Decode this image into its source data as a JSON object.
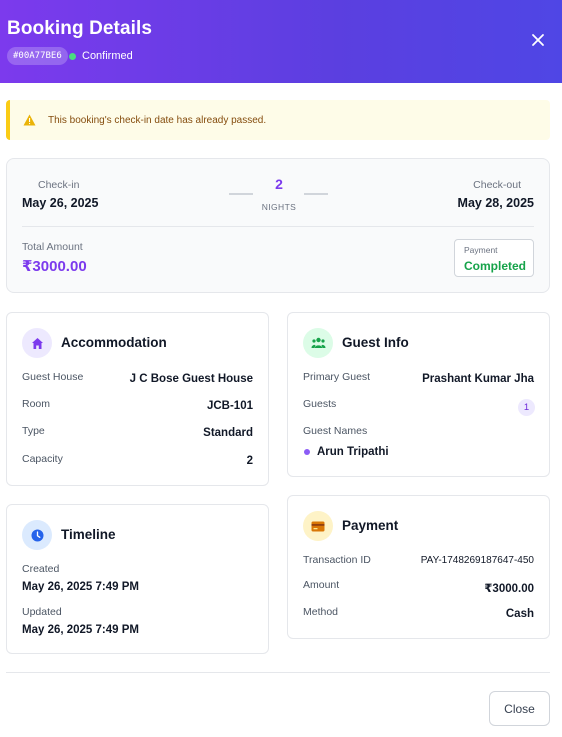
{
  "header": {
    "title": "Booking Details",
    "booking_id": "#00A77BE6",
    "status": "Confirmed",
    "close_icon": "close-icon"
  },
  "alert": {
    "icon": "warning-icon",
    "text": "This booking's check-in date has already passed."
  },
  "summary": {
    "checkin_label": "Check-in",
    "checkin_date": "May 26, 2025",
    "nights_value": "2",
    "nights_label": "NIGHTS",
    "checkout_label": "Check-out",
    "checkout_date": "May 28, 2025",
    "total_label": "Total Amount",
    "total_value": "₹3000.00",
    "payment_label": "Payment",
    "payment_status": "Completed"
  },
  "accommodation": {
    "title": "Accommodation",
    "icon": "home-icon",
    "rows": [
      {
        "label": "Guest House",
        "value": "J C Bose Guest House"
      },
      {
        "label": "Room",
        "value": "JCB-101"
      },
      {
        "label": "Type",
        "value": "Standard"
      },
      {
        "label": "Capacity",
        "value": "2"
      }
    ]
  },
  "guest_info": {
    "title": "Guest Info",
    "icon": "users-icon",
    "primary_label": "Primary Guest",
    "primary_value": "Prashant Kumar Jha",
    "guests_label": "Guests",
    "guests_count": "1",
    "names_label": "Guest Names",
    "names": [
      "Arun Tripathi"
    ]
  },
  "timeline": {
    "title": "Timeline",
    "icon": "clock-icon",
    "created_label": "Created",
    "created_value": "May 26, 2025 7:49 PM",
    "updated_label": "Updated",
    "updated_value": "May 26, 2025 7:49 PM"
  },
  "payment": {
    "title": "Payment",
    "icon": "credit-card-icon",
    "rows": [
      {
        "label": "Transaction ID",
        "value": "PAY-1748269187647-450"
      },
      {
        "label": "Amount",
        "value": "₹3000.00"
      },
      {
        "label": "Method",
        "value": "Cash"
      }
    ]
  },
  "footer": {
    "close_label": "Close"
  },
  "colors": {
    "header_gradient_start": "#7c3aed",
    "header_gradient_end": "#4f46e5",
    "accent": "#7c3aed",
    "success": "#16a34a",
    "warning": "#facc15"
  }
}
